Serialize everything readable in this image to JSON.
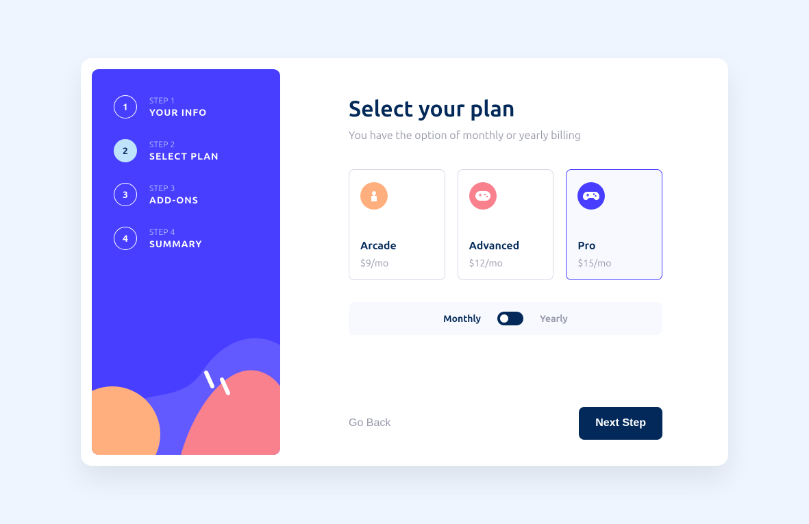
{
  "sidebar": {
    "steps": [
      {
        "num": "1",
        "label": "STEP 1",
        "title": "YOUR INFO",
        "active": false
      },
      {
        "num": "2",
        "label": "STEP 2",
        "title": "SELECT PLAN",
        "active": true
      },
      {
        "num": "3",
        "label": "STEP 3",
        "title": "ADD-ONS",
        "active": false
      },
      {
        "num": "4",
        "label": "STEP 4",
        "title": "SUMMARY",
        "active": false
      }
    ]
  },
  "main": {
    "heading": "Select your plan",
    "subheading": "You have the option of monthly or yearly billing"
  },
  "plans": [
    {
      "name": "Arcade",
      "price": "$9/mo",
      "icon": "arcade-icon",
      "color": "#ffaf7e",
      "selected": false
    },
    {
      "name": "Advanced",
      "price": "$12/mo",
      "icon": "advanced-icon",
      "color": "#f9818e",
      "selected": false
    },
    {
      "name": "Pro",
      "price": "$15/mo",
      "icon": "pro-icon",
      "color": "#483eff",
      "selected": true
    }
  ],
  "billing": {
    "monthly_label": "Monthly",
    "yearly_label": "Yearly",
    "active": "monthly"
  },
  "footer": {
    "back_label": "Go Back",
    "next_label": "Next Step"
  },
  "colors": {
    "sidebar_bg": "#483eff",
    "accent_pink": "#f9818e",
    "accent_orange": "#ffaf7e",
    "accent_lightblue": "#bfe2fd",
    "dark_blue": "#022959"
  }
}
